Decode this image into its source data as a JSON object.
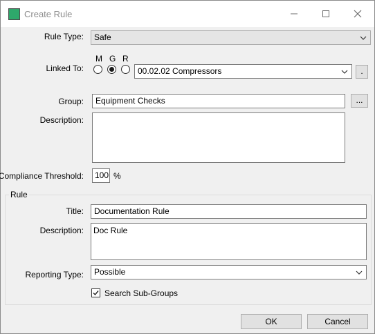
{
  "window": {
    "title": "Create Rule",
    "minimize_icon": "minimize-icon",
    "maximize_icon": "maximize-icon",
    "close_icon": "close-icon"
  },
  "form": {
    "rule_type_label": "Rule Type:",
    "rule_type_value": "Safe",
    "linked_to_label": "Linked To:",
    "radio_options": [
      "M",
      "G",
      "R"
    ],
    "radio_selected": "G",
    "linked_value": "00.02.02 Compressors",
    "linked_browse_label": ".",
    "group_label": "Group:",
    "group_value": "Equipment Checks",
    "group_browse_label": "...",
    "description_label": "Description:",
    "description_value": "",
    "compliance_label": "Compliance Threshold:",
    "compliance_value": "100",
    "compliance_unit": "%"
  },
  "rule": {
    "section_label": "Rule",
    "title_label": "Title:",
    "title_value": "Documentation Rule",
    "description_label": "Description:",
    "description_value": "Doc Rule",
    "reporting_label": "Reporting Type:",
    "reporting_value": "Possible",
    "search_subgroups_label": "Search Sub-Groups",
    "search_subgroups_checked": true
  },
  "buttons": {
    "ok": "OK",
    "cancel": "Cancel"
  }
}
